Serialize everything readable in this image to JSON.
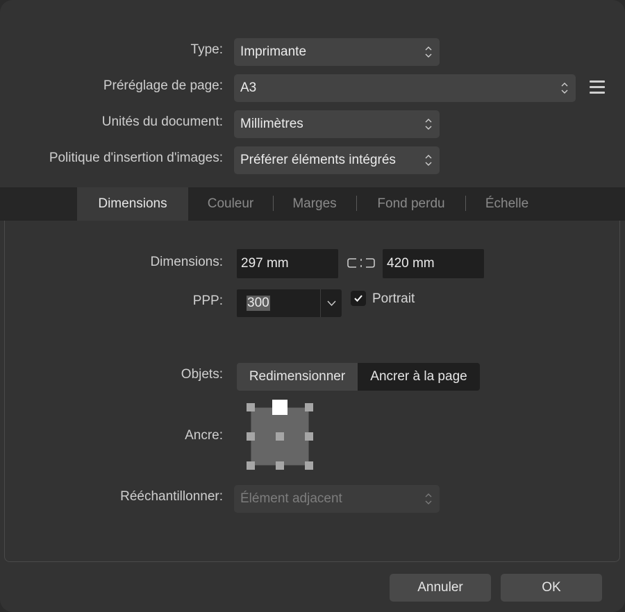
{
  "form": {
    "type": {
      "label": "Type:",
      "value": "Imprimante"
    },
    "preset": {
      "label": "Préréglage de page:",
      "value": "A3"
    },
    "units": {
      "label": "Unités du document:",
      "value": "Millimètres"
    },
    "image_policy": {
      "label": "Politique d'insertion d'images:",
      "value": "Préférer éléments intégrés"
    }
  },
  "tabs": [
    {
      "label": "Dimensions",
      "active": true
    },
    {
      "label": "Couleur",
      "active": false
    },
    {
      "label": "Marges",
      "active": false
    },
    {
      "label": "Fond perdu",
      "active": false
    },
    {
      "label": "Échelle",
      "active": false
    }
  ],
  "dimensions": {
    "label": "Dimensions:",
    "width": "297 mm",
    "height": "420 mm",
    "link_icon": "link-chain-icon"
  },
  "ppp": {
    "label": "PPP:",
    "value": "300",
    "portrait_label": "Portrait",
    "portrait_checked": true
  },
  "objects": {
    "label": "Objets:",
    "options": [
      "Redimensionner",
      "Ancrer à la page"
    ],
    "selected": "Ancrer à la page"
  },
  "anchor": {
    "label": "Ancre:",
    "selected": "top-center"
  },
  "resample": {
    "label": "Rééchantillonner:",
    "value": "Élément adjacent",
    "disabled": true
  },
  "buttons": {
    "cancel": "Annuler",
    "ok": "OK"
  },
  "colors": {
    "background": "#333333",
    "tabbar": "#262626",
    "field": "#1f1f1f"
  }
}
